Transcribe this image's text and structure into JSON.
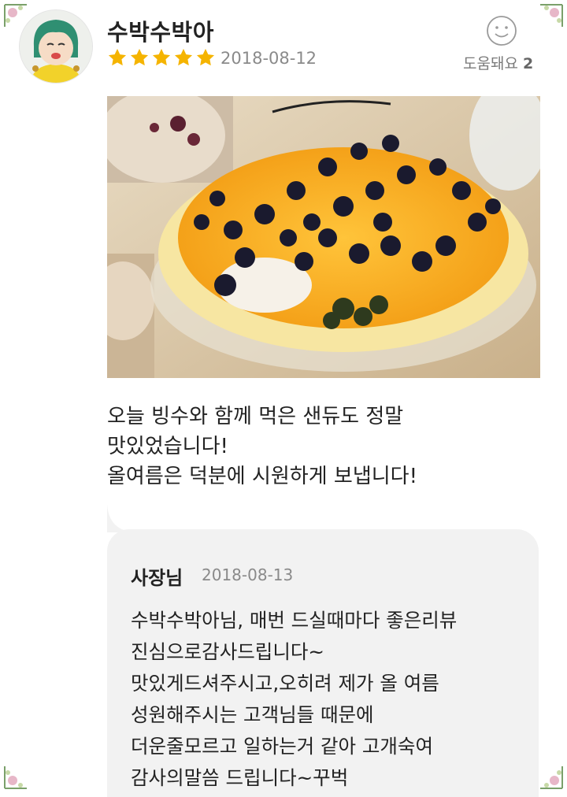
{
  "review": {
    "username": "수박수박아",
    "rating": 5,
    "date": "2018-08-12",
    "helpful_label": "도움돼요",
    "helpful_count": "2",
    "text_lines": [
      "오늘 빙수와 함께 먹은 샌듀도 정말",
      "맛있었습니다!",
      "올여름은 덕분에 시원하게 보냅니다!"
    ]
  },
  "reply": {
    "author": "사장님",
    "date": "2018-08-13",
    "text_lines": [
      "수박수박아님, 매번 드실때마다 좋은리뷰",
      "진심으로감사드립니다~",
      "맛있게드셔주시고,오히려 제가 올 여름",
      "성원해주시는 고객님들 때문에",
      "더운줄모르고 일하는거 같아 고개숙여",
      "감사의말씀 드립니다~꾸벅"
    ]
  },
  "icons": {
    "avatar": "avatar-character-icon",
    "star": "star-icon",
    "helpful": "smiley-icon",
    "corner": "flower-corner-icon"
  },
  "colors": {
    "star": "#f5b400",
    "reply_bg": "#f2f2f2",
    "muted_text": "#8a8a8a"
  }
}
